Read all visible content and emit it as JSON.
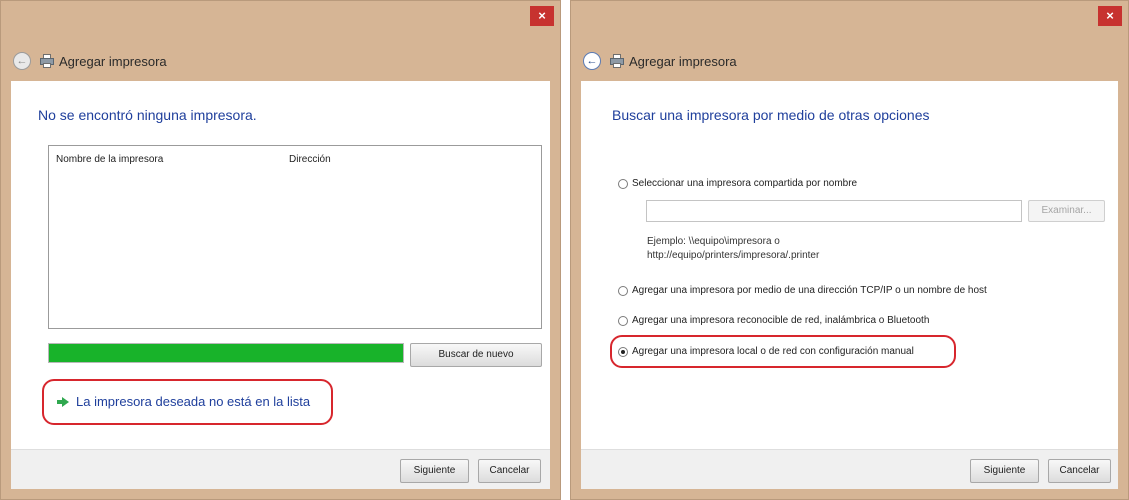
{
  "left_window": {
    "close_label": "×",
    "back_label": "←",
    "title": "Agregar impresora",
    "heading": "No se encontró ninguna impresora.",
    "columns": [
      "Nombre de la impresora",
      "Dirección"
    ],
    "progress_percent": 100,
    "search_again_label": "Buscar de nuevo",
    "not_listed_link": "La impresora deseada no está en la lista",
    "next_label": "Siguiente",
    "cancel_label": "Cancelar"
  },
  "right_window": {
    "close_label": "×",
    "back_label": "←",
    "title": "Agregar impresora",
    "heading": "Buscar una impresora por medio de otras opciones",
    "options": [
      "Seleccionar una impresora compartida por nombre",
      "Agregar una impresora por medio de una dirección TCP/IP o un nombre de host",
      "Agregar una impresora reconocible de red, inalámbrica o Bluetooth",
      "Agregar una impresora local o de red con configuración manual"
    ],
    "selected_option": 3,
    "shared_name_value": "",
    "browse_label": "Examinar...",
    "example_line1": "Ejemplo: \\\\equipo\\impresora o",
    "example_line2": "http://equipo/printers/impresora/.printer",
    "next_label": "Siguiente",
    "cancel_label": "Cancelar"
  },
  "colors": {
    "frame": "#d6b595",
    "heading_blue": "#1f3f9c",
    "progress_green": "#18b32a",
    "highlight_red": "#d7262d",
    "close_red": "#c7322f"
  }
}
